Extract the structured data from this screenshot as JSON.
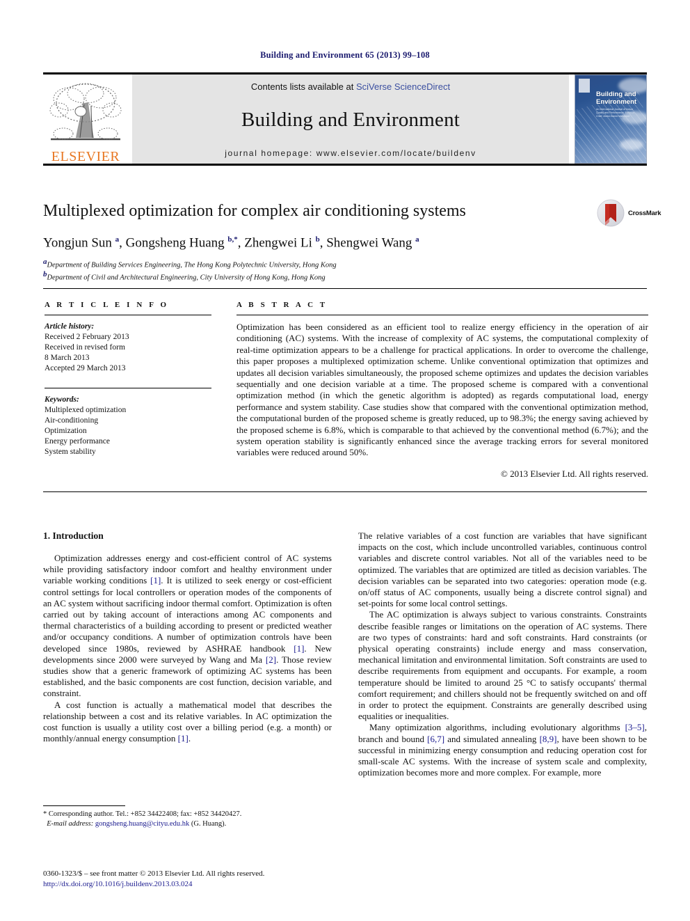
{
  "running_head": "Building and Environment 65 (2013) 99–108",
  "journal_header": {
    "contents_prefix": "Contents lists available at ",
    "sciencedirect": "SciVerse ScienceDirect",
    "journal_name": "Building and Environment",
    "homepage": "journal homepage: www.elsevier.com/locate/buildenv",
    "publisher_logo_text": "ELSEVIER",
    "cover_title_line1": "Building and",
    "cover_title_line2": "Environment",
    "cover_subtitle": "An International Journal of Indoor Quality and Performance. Editor-in-Chief: Abdul-Hamid Mahmoud",
    "colors": {
      "link": "#3b4fa0",
      "elsevier_orange": "#E87722",
      "band_gray": "#e4e4e4",
      "cover_blue": "#2c4d88"
    }
  },
  "article": {
    "title": "Multiplexed optimization for complex air conditioning systems",
    "authors_html": "Yongjun Sun <sup>a</sup>, Gongsheng Huang <sup>b,*</sup>, Zhengwei Li <sup>b</sup>, Shengwei Wang <sup>a</sup>",
    "affiliation_a": "Department of Building Services Engineering, The Hong Kong Polytechnic University, Hong Kong",
    "affiliation_b": "Department of Civil and Architectural Engineering, City University of Hong Kong, Hong Kong",
    "crossmark_label": "CrossMark"
  },
  "article_info": {
    "heading": "A R T I C L E  I N F O",
    "history_label": "Article history:",
    "history": [
      "Received 2 February 2013",
      "Received in revised form",
      "8 March 2013",
      "Accepted 29 March 2013"
    ],
    "keywords_label": "Keywords:",
    "keywords": [
      "Multiplexed optimization",
      "Air-conditioning",
      "Optimization",
      "Energy performance",
      "System stability"
    ]
  },
  "abstract": {
    "heading": "A B S T R A C T",
    "text": "Optimization has been considered as an efficient tool to realize energy efficiency in the operation of air conditioning (AC) systems. With the increase of complexity of AC systems, the computational complexity of real-time optimization appears to be a challenge for practical applications. In order to overcome the challenge, this paper proposes a multiplexed optimization scheme. Unlike conventional optimization that optimizes and updates all decision variables simultaneously, the proposed scheme optimizes and updates the decision variables sequentially and one decision variable at a time. The proposed scheme is compared with a conventional optimization method (in which the genetic algorithm is adopted) as regards computational load, energy performance and system stability. Case studies show that compared with the conventional optimization method, the computational burden of the proposed scheme is greatly reduced, up to 98.3%; the energy saving achieved by the proposed scheme is 6.8%, which is comparable to that achieved by the conventional method (6.7%); and the system operation stability is significantly enhanced since the average tracking errors for several monitored variables were reduced around 50%.",
    "copyright": "© 2013 Elsevier Ltd. All rights reserved."
  },
  "body": {
    "section_heading": "1. Introduction",
    "left_paragraphs": [
      "Optimization addresses energy and cost-efficient control of AC systems while providing satisfactory indoor comfort and healthy environment under variable working conditions [1]. It is utilized to seek energy or cost-efficient control settings for local controllers or operation modes of the components of an AC system without sacrificing indoor thermal comfort. Optimization is often carried out by taking account of interactions among AC components and thermal characteristics of a building according to present or predicted weather and/or occupancy conditions. A number of optimization controls have been developed since 1980s, reviewed by ASHRAE handbook [1]. New developments since 2000 were surveyed by Wang and Ma [2]. Those review studies show that a generic framework of optimizing AC systems has been established, and the basic components are cost function, decision variable, and constraint.",
      "A cost function is actually a mathematical model that describes the relationship between a cost and its relative variables. In AC optimization the cost function is usually a utility cost over a billing period (e.g. a month) or monthly/annual energy consumption [1]."
    ],
    "right_paragraphs": [
      "The relative variables of a cost function are variables that have significant impacts on the cost, which include uncontrolled variables, continuous control variables and discrete control variables. Not all of the variables need to be optimized. The variables that are optimized are titled as decision variables. The decision variables can be separated into two categories: operation mode (e.g. on/off status of AC components, usually being a discrete control signal) and set-points for some local control settings.",
      "The AC optimization is always subject to various constraints. Constraints describe feasible ranges or limitations on the operation of AC systems. There are two types of constraints: hard and soft constraints. Hard constraints (or physical operating constraints) include energy and mass conservation, mechanical limitation and environmental limitation. Soft constraints are used to describe requirements from equipment and occupants. For example, a room temperature should be limited to around 25 °C to satisfy occupants' thermal comfort requirement; and chillers should not be frequently switched on and off in order to protect the equipment. Constraints are generally described using equalities or inequalities.",
      "Many optimization algorithms, including evolutionary algorithms [3–5], branch and bound [6,7] and simulated annealing [8,9], have been shown to be successful in minimizing energy consumption and reducing operation cost for small-scale AC systems. With the increase of system scale and complexity, optimization becomes more and more complex. For example, more"
    ]
  },
  "footnote": {
    "corresponding": "* Corresponding author. Tel.: +852 34422408; fax: +852 34420427.",
    "email_label": "E-mail address:",
    "email": "gongsheng.huang@cityu.edu.hk",
    "email_suffix": "(G. Huang)."
  },
  "footer": {
    "issn_line": "0360-1323/$ – see front matter © 2013 Elsevier Ltd. All rights reserved.",
    "doi": "http://dx.doi.org/10.1016/j.buildenv.2013.03.024"
  }
}
